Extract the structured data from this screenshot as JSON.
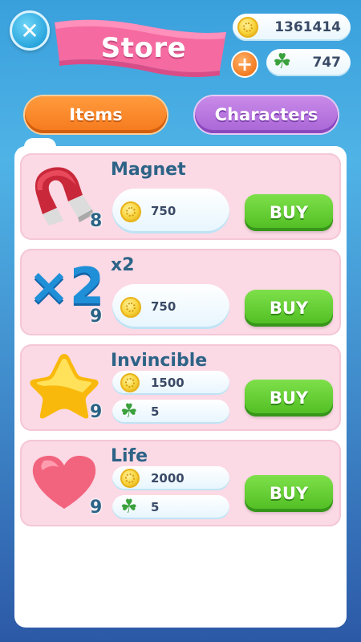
{
  "header": {
    "title": "Store",
    "coins": "1361414",
    "clovers": "747"
  },
  "tabs": [
    {
      "label": "Items",
      "active": true
    },
    {
      "label": "Characters",
      "active": false
    }
  ],
  "items": [
    {
      "name": "Magnet",
      "count": "8",
      "prices": [
        {
          "currency": "coin",
          "amount": "750"
        }
      ],
      "buy_label": "BUY",
      "icon": "magnet-icon"
    },
    {
      "name": "x2",
      "count": "9",
      "prices": [
        {
          "currency": "coin",
          "amount": "750"
        }
      ],
      "buy_label": "BUY",
      "icon": "x2-icon"
    },
    {
      "name": "Invincible",
      "count": "9",
      "prices": [
        {
          "currency": "coin",
          "amount": "1500"
        },
        {
          "currency": "clover",
          "amount": "5"
        }
      ],
      "buy_label": "BUY",
      "icon": "star-icon"
    },
    {
      "name": "Life",
      "count": "9",
      "prices": [
        {
          "currency": "coin",
          "amount": "2000"
        },
        {
          "currency": "clover",
          "amount": "5"
        }
      ],
      "buy_label": "BUY",
      "icon": "heart-icon"
    }
  ],
  "icon_text": {
    "x2": "×2"
  },
  "colors": {
    "buy_green": "#4fbc22",
    "items_tab": "#f5791d",
    "characters_tab": "#a865d6",
    "card_pink": "#fbd9e5",
    "title_ribbon": "#f56aa0"
  }
}
